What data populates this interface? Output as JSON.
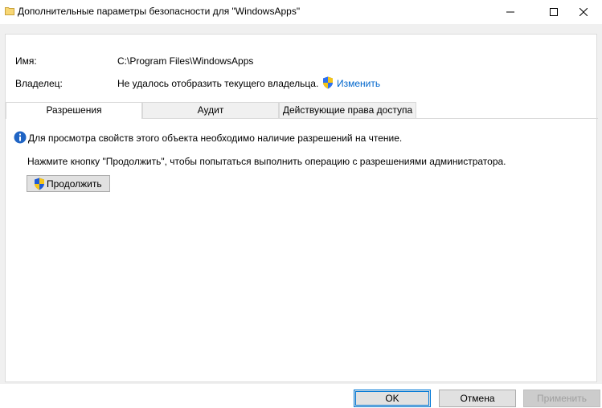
{
  "window": {
    "title": "Дополнительные параметры безопасности  для \"WindowsApps\"",
    "icons": {
      "title": "folder-icon",
      "minimize": "minimize-icon",
      "maximize": "maximize-icon",
      "close": "close-icon"
    }
  },
  "fields": {
    "name_label": "Имя:",
    "name_value": "C:\\Program Files\\WindowsApps",
    "owner_label": "Владелец:",
    "owner_value": "Не удалось отобразить текущего владельца.",
    "change_link": "Изменить",
    "shield_icon": "uac-shield-icon"
  },
  "tabs": [
    {
      "label": "Разрешения",
      "selected": true
    },
    {
      "label": "Аудит",
      "selected": false
    },
    {
      "label": "Действующие права доступа",
      "selected": false
    }
  ],
  "permissions_tab": {
    "info_icon": "info-icon",
    "info_text": "Для просмотра свойств этого объекта необходимо наличие разрешений на чтение.",
    "press_text": "Нажмите кнопку \"Продолжить\", чтобы попытаться выполнить операцию с разрешениями администратора.",
    "continue_label": "Продолжить"
  },
  "footer": {
    "ok_label": "OK",
    "cancel_label": "Отмена",
    "apply_label": "Применить",
    "apply_enabled": false
  },
  "colors": {
    "link": "#0066cc",
    "focus_border": "#0078d7",
    "dialog_bg": "#f0f0f0"
  }
}
